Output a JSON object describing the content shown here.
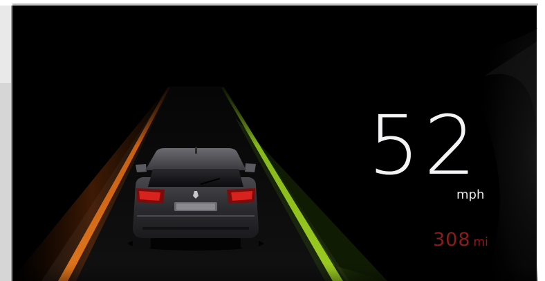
{
  "cluster": {
    "speed": "52",
    "speed_unit": "mph",
    "range_value": "308",
    "range_unit": "mi"
  },
  "icons": {
    "vehicle": "car-rear-view-icon",
    "lane_left": "lane-marking-left-icon",
    "lane_right": "lane-marking-right-icon"
  },
  "colors": {
    "background": "#000000",
    "lane_left": "#d9701a",
    "lane_right": "#8fc21c",
    "speed_text": "#f4f4f6",
    "range_text": "#8c1c1c"
  }
}
